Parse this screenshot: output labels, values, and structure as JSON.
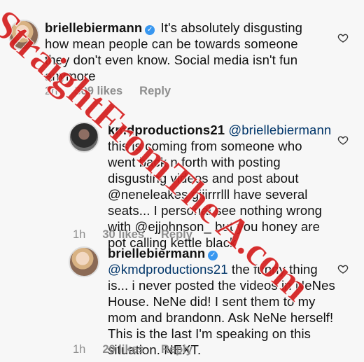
{
  "comments": [
    {
      "username": "briellebiermann",
      "verified": true,
      "mention": "",
      "text": "It's absolutely disgusting how mean people can be towards someone they don't even know. Social media isn't fun anymore",
      "time": "2h",
      "likes": "309 likes",
      "reply": "Reply"
    },
    {
      "username": "kmdproductions21",
      "verified": false,
      "mention": "@briellebiermann",
      "text": "this is coming from someone who went back n forth with posting disgusting videos and post about @neneleakes giiirrrlll have several seats... I personal see nothing wrong with @ejjohnson_ but you honey are pot calling kettle black",
      "time": "1h",
      "likes": "30 likes",
      "reply": "Reply"
    },
    {
      "username": "briellebiermann",
      "verified": true,
      "mention": "@kmdproductions21",
      "text": "the funny thing is... i never posted the videos in NeNes House. NeNe did! I sent them to my mom and brandonn. Ask NeNe herself! This is the last I'm speaking on this situation. NEXT.",
      "time": "1h",
      "likes": "20 likes",
      "reply": "Reply"
    }
  ],
  "watermark": "StraightFromThe A.com",
  "icons": {
    "verified": "verified-badge-icon",
    "like": "heart-icon",
    "avatar": "avatar"
  },
  "colors": {
    "verified": "#3897f0",
    "mention": "#003569",
    "meta": "#8e8e8e",
    "watermark": "#cc0000"
  }
}
